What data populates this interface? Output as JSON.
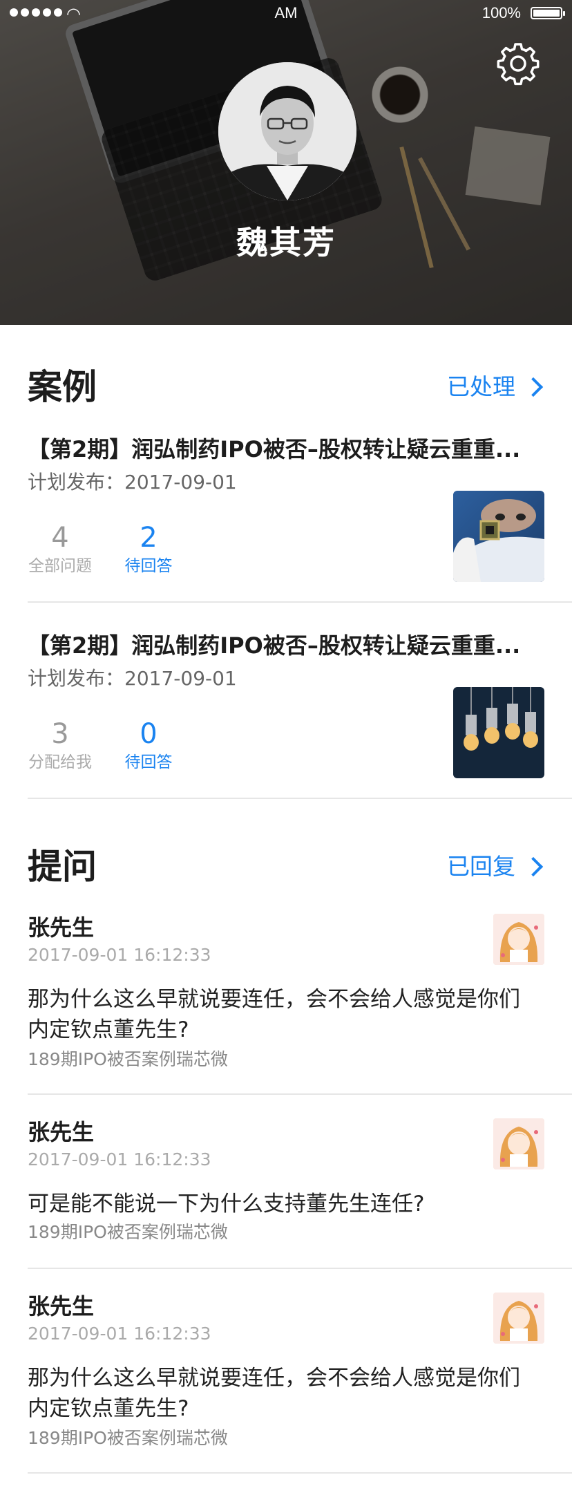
{
  "status_bar": {
    "time": "AM",
    "battery": "100%"
  },
  "profile": {
    "name": "魏其芳"
  },
  "cases": {
    "title": "案例",
    "link": "已处理",
    "items": [
      {
        "title": "【第2期】润弘制药IPO被否–股权转让疑云重重...",
        "plan_label": "计划发布：",
        "plan_date": "2017-09-01",
        "stat1_value": "4",
        "stat1_label": "全部问题",
        "stat2_value": "2",
        "stat2_label": "待回答"
      },
      {
        "title": "【第2期】润弘制药IPO被否–股权转让疑云重重...",
        "plan_label": "计划发布：",
        "plan_date": "2017-09-01",
        "stat1_value": "3",
        "stat1_label": "分配给我",
        "stat2_value": "0",
        "stat2_label": "待回答"
      }
    ]
  },
  "questions": {
    "title": "提问",
    "link": "已回复",
    "items": [
      {
        "author": "张先生",
        "time": "2017-09-01 16:12:33",
        "text": "那为什么这么早就说要连任，会不会给人感觉是你们内定钦点董先生?",
        "source": "189期IPO被否案例瑞芯微"
      },
      {
        "author": "张先生",
        "time": "2017-09-01 16:12:33",
        "text": "可是能不能说一下为什么支持董先生连任?",
        "source": "189期IPO被否案例瑞芯微"
      },
      {
        "author": "张先生",
        "time": "2017-09-01 16:12:33",
        "text": "那为什么这么早就说要连任，会不会给人感觉是你们内定钦点董先生?",
        "source": "189期IPO被否案例瑞芯微"
      }
    ]
  },
  "colors": {
    "accent": "#1a83f0",
    "muted": "#999999",
    "title": "#1d1d1d"
  },
  "icons": {
    "settings": "gear-icon",
    "chevron": "chevron-right-icon"
  }
}
